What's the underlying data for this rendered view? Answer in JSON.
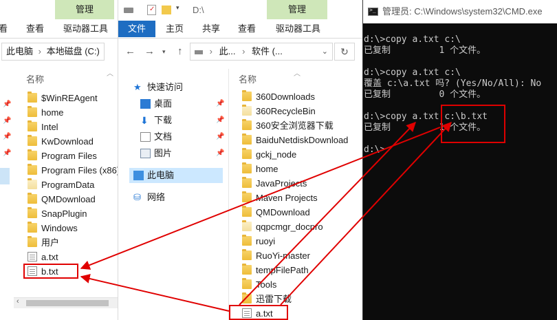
{
  "left_explorer": {
    "ctx_tab": "管理",
    "tabs": [
      "看",
      "查看",
      "驱动器工具"
    ],
    "breadcrumb": [
      "此电脑",
      "本地磁盘 (C:)"
    ],
    "column_name": "名称",
    "files": [
      {
        "name": "$WinREAgent",
        "type": "folder"
      },
      {
        "name": "home",
        "type": "folder"
      },
      {
        "name": "Intel",
        "type": "folder"
      },
      {
        "name": "KwDownload",
        "type": "folder"
      },
      {
        "name": "Program Files",
        "type": "folder"
      },
      {
        "name": "Program Files (x86)",
        "type": "folder"
      },
      {
        "name": "ProgramData",
        "type": "folder-light"
      },
      {
        "name": "QMDownload",
        "type": "folder"
      },
      {
        "name": "SnapPlugin",
        "type": "folder"
      },
      {
        "name": "Windows",
        "type": "folder"
      },
      {
        "name": "用户",
        "type": "folder"
      },
      {
        "name": "a.txt",
        "type": "file"
      },
      {
        "name": "b.txt",
        "type": "file"
      }
    ]
  },
  "mid_explorer": {
    "title_path": "D:\\",
    "ctx_tab": "管理",
    "tabs": [
      "文件",
      "主页",
      "共享",
      "查看",
      "驱动器工具"
    ],
    "breadcrumb": [
      "此...",
      "软件 (..."
    ],
    "column_name": "名称",
    "nav": [
      {
        "label": "快速访问",
        "icon": "star-icon"
      },
      {
        "label": "桌面",
        "icon": "desktop-icon"
      },
      {
        "label": "下载",
        "icon": "download-icon"
      },
      {
        "label": "文档",
        "icon": "document-icon"
      },
      {
        "label": "图片",
        "icon": "picture-icon"
      },
      {
        "label": "此电脑",
        "icon": "computer-icon"
      },
      {
        "label": "网络",
        "icon": "network-icon"
      }
    ],
    "files": [
      {
        "name": "360Downloads",
        "type": "folder"
      },
      {
        "name": "360RecycleBin",
        "type": "folder-light"
      },
      {
        "name": "360安全浏览器下载",
        "type": "folder"
      },
      {
        "name": "BaiduNetdiskDownload",
        "type": "folder"
      },
      {
        "name": "gckj_node",
        "type": "folder"
      },
      {
        "name": "home",
        "type": "folder"
      },
      {
        "name": "JavaProjects",
        "type": "folder"
      },
      {
        "name": "Maven Projects",
        "type": "folder"
      },
      {
        "name": "QMDownload",
        "type": "folder"
      },
      {
        "name": "qqpcmgr_docpro",
        "type": "folder-light"
      },
      {
        "name": "ruoyi",
        "type": "folder"
      },
      {
        "name": "RuoYi-master",
        "type": "folder"
      },
      {
        "name": "tempFilePath",
        "type": "folder"
      },
      {
        "name": "Tools",
        "type": "folder"
      },
      {
        "name": "迅雷下载",
        "type": "folder"
      },
      {
        "name": "a.txt",
        "type": "file"
      }
    ]
  },
  "cmd": {
    "title": "管理员: C:\\Windows\\system32\\CMD.exe",
    "lines": [
      "d:\\>copy a.txt c:\\",
      "已复制         1 个文件。",
      "",
      "d:\\>copy a.txt c:\\",
      "覆盖 c:\\a.txt 吗? (Yes/No/All): No",
      "已复制         0 个文件。",
      "",
      "d:\\>copy a.txt c:\\b.txt",
      "已复制         1 个文件。",
      "",
      "d:\\>"
    ]
  },
  "colors": {
    "annotation_red": "#e00000",
    "file_tab_blue": "#1e6dc2",
    "context_tab_green": "#cfe7b9",
    "console_bg": "#0c0c0c",
    "console_fg": "#cccccc"
  }
}
